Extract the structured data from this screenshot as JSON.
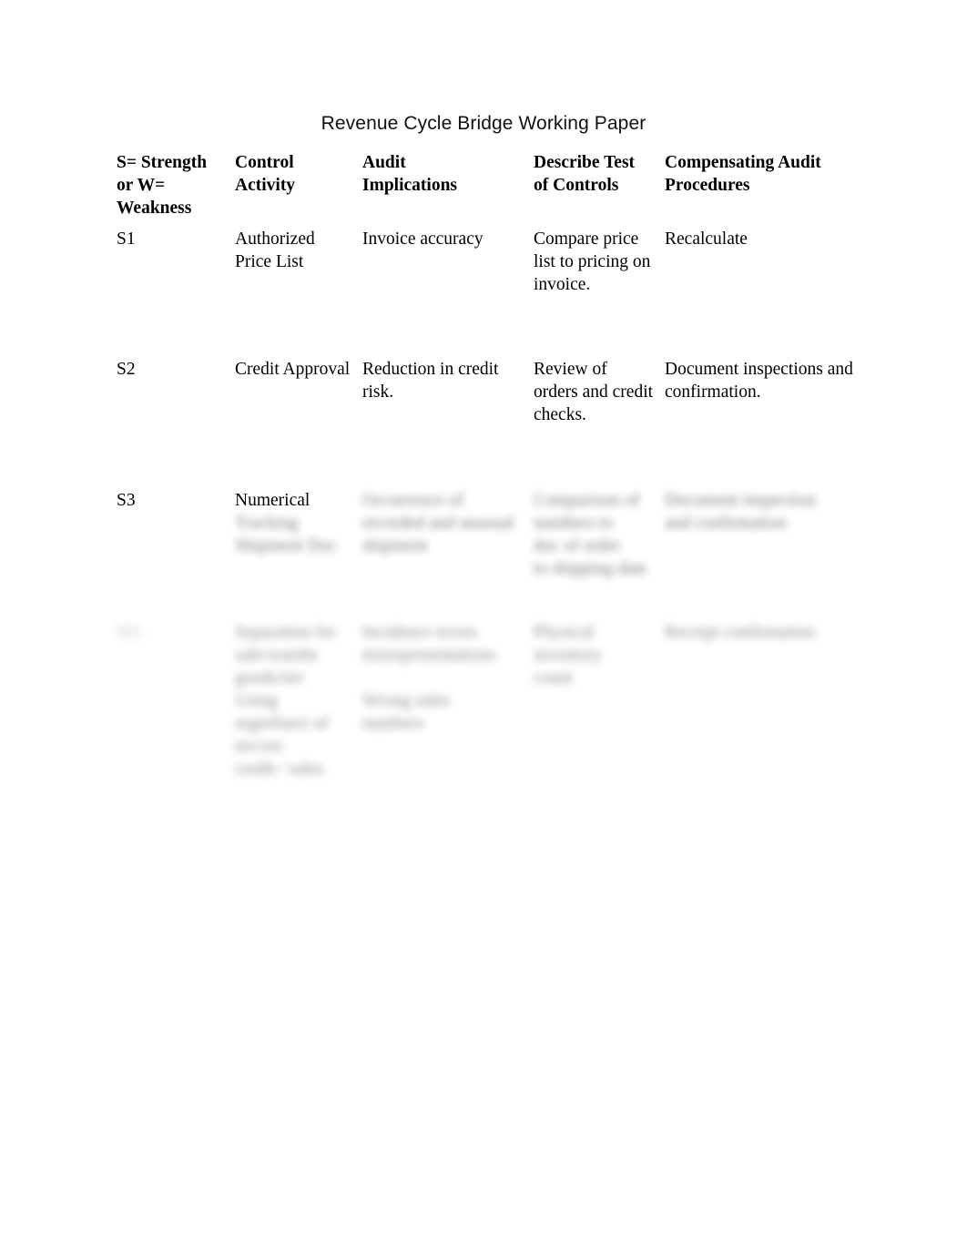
{
  "document": {
    "title": "Revenue Cycle Bridge Working Paper",
    "background_color": "#ffffff",
    "text_color": "#000000"
  },
  "table": {
    "headers": [
      "S= Strength or W= Weakness",
      "Control Activity",
      "Audit Implications",
      "Describe Test of Controls",
      "Compensating Audit Procedures"
    ],
    "header_lines": {
      "col1": [
        "S= Strength",
        "or W=",
        "Weakness"
      ],
      "col2": [
        "Control",
        "Activity"
      ],
      "col3": [
        "Audit",
        "Implications"
      ],
      "col4": [
        "Describe Test",
        "of Controls"
      ],
      "col5": [
        "Compensating Audit",
        "Procedures"
      ]
    },
    "rows": [
      {
        "id": "S1",
        "redacted": false,
        "marker": "S1",
        "control_activity": "Authorized Price List",
        "audit_implications": "Invoice accuracy",
        "test_of_controls": "Compare price list to pricing on invoice.",
        "compensating_procedures": "Recalculate"
      },
      {
        "id": "S2",
        "redacted": false,
        "marker": "S2",
        "control_activity": "Credit Approval",
        "audit_implications": "Reduction in credit risk.",
        "test_of_controls": "Review of orders and credit checks.",
        "compensating_procedures": "Document inspections and confirmation."
      },
      {
        "id": "S3",
        "redacted": true,
        "marker": "S3",
        "control_activity_visible": "Numerical",
        "control_activity_redacted": [
          "Tracking",
          "Shipment Doc"
        ],
        "audit_implications_redacted": [
          "Occurrence of",
          "recorded and unusual",
          "shipment"
        ],
        "test_of_controls_redacted": [
          "Comparison of",
          "numbers to",
          "doc of order",
          "to shipping date"
        ],
        "compensating_procedures_redacted": [
          "Document inspection",
          "and confirmation"
        ]
      },
      {
        "id": "row-4",
        "redacted": true,
        "marker_redacted": "W1",
        "control_activity_redacted": [
          "Separation for",
          "sale/warehs",
          "goods/inv",
          "Using",
          "segrefunct of",
          "inv/rec",
          "credit / sales"
        ],
        "audit_implications_redacted": [
          "Incidence errors",
          "misrepresentations",
          "",
          "Wrong sales",
          "numbers"
        ],
        "test_of_controls_redacted": [
          "Physical",
          "inventory",
          "count"
        ],
        "compensating_procedures_redacted": [
          "Receipt confirmation"
        ]
      }
    ]
  }
}
